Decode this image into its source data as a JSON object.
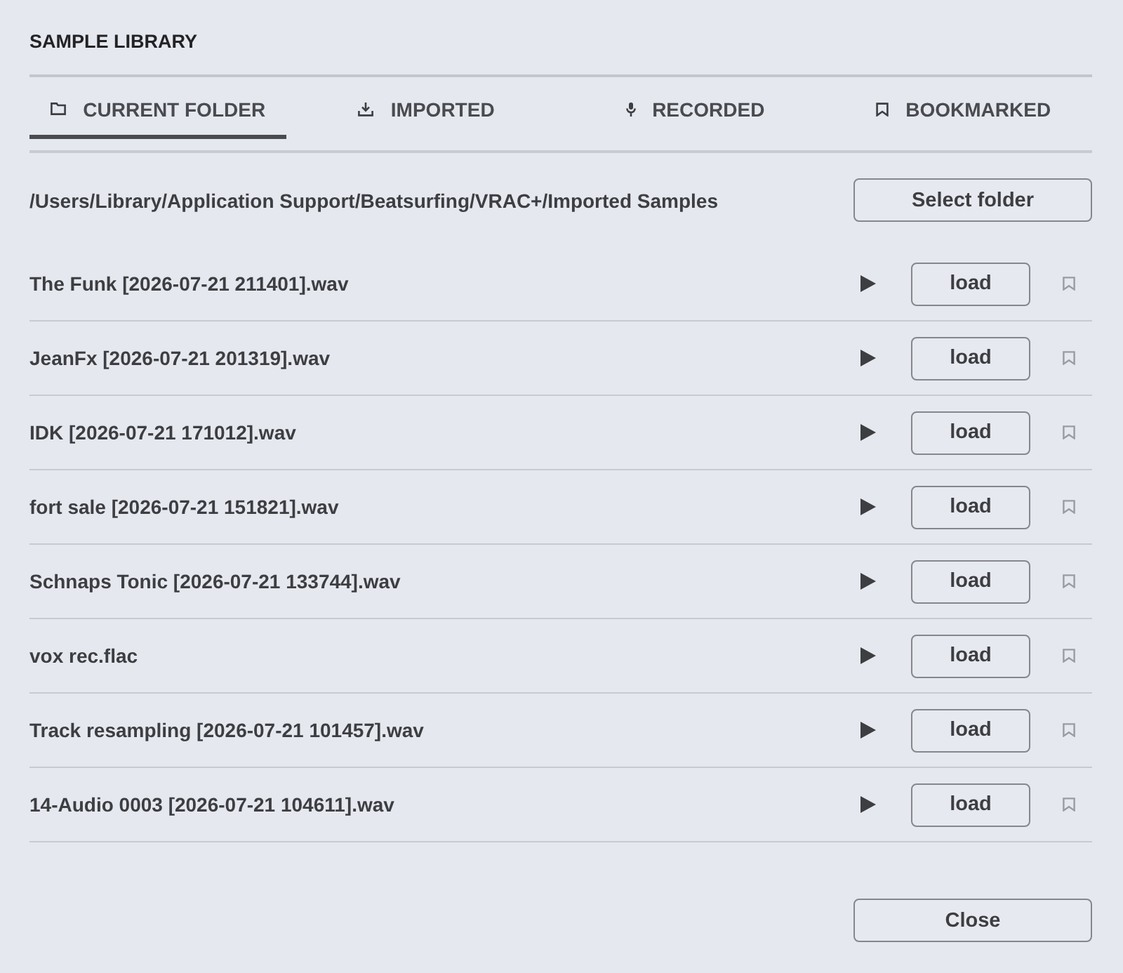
{
  "dialog": {
    "title": "SAMPLE LIBRARY"
  },
  "tabs": [
    {
      "label": "CURRENT FOLDER",
      "kind": "folder",
      "selected": true
    },
    {
      "label": "IMPORTED",
      "kind": "import",
      "selected": false
    },
    {
      "label": "RECORDED",
      "kind": "record",
      "selected": false
    },
    {
      "label": "BOOKMARKED",
      "kind": "bookmark",
      "selected": false
    }
  ],
  "folder": {
    "path": "/Users/Library/Application Support/Beatsurfing/VRAC+/Imported Samples",
    "button": "Select folder"
  },
  "samples": [
    {
      "name": "The Funk [2026-07-21 211401].wav",
      "button": "load",
      "bookmarked": false
    },
    {
      "name": "JeanFx [2026-07-21 201319].wav",
      "button": "load",
      "bookmarked": false
    },
    {
      "name": "IDK [2026-07-21 171012].wav",
      "button": "load",
      "bookmarked": false
    },
    {
      "name": "fort sale [2026-07-21 151821].wav",
      "button": "load",
      "bookmarked": false
    },
    {
      "name": "Schnaps Tonic [2026-07-21 133744].wav",
      "button": "load",
      "bookmarked": false
    },
    {
      "name": "vox rec.flac",
      "button": "load",
      "bookmarked": false
    },
    {
      "name": "Track resampling [2026-07-21 101457].wav",
      "button": "load",
      "bookmarked": false
    },
    {
      "name": "14-Audio 0003 [2026-07-21 104611].wav",
      "button": "load",
      "bookmarked": false
    }
  ],
  "footer": {
    "button": "Close"
  }
}
